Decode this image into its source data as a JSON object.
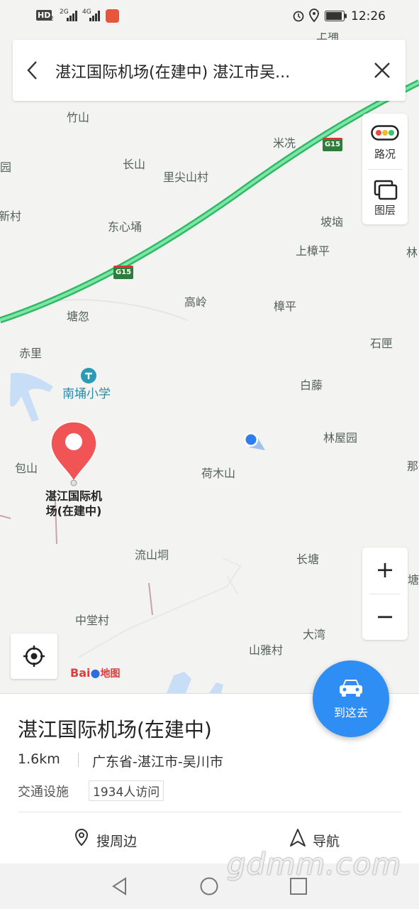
{
  "status": {
    "hd": "HD",
    "hd_sub": "2",
    "net1": "2G",
    "net2": "4G",
    "time": "12:26"
  },
  "search": {
    "title": "湛江国际机场(在建中) 湛江市吴..."
  },
  "side": {
    "traffic_label": "路况",
    "layers_label": "图层"
  },
  "map": {
    "highway_label": "G15",
    "places": [
      "上埇",
      "竹山",
      "米冼",
      "园",
      "长山",
      "里尖山村",
      "新村",
      "东心埇",
      "坡垴",
      "上樟平",
      "林",
      "高岭",
      "樟平",
      "塘忽",
      "赤里",
      "石匣",
      "白藤",
      "包山",
      "林屋园",
      "荷木山",
      "那",
      "流山垌",
      "长塘",
      "塘",
      "中堂村",
      "大湾",
      "山雅村"
    ],
    "poi_school": "南埇小学",
    "pin_label_line1": "湛江国际机",
    "pin_label_line2": "场(在建中)",
    "logo_text": "Bai",
    "logo_suffix": "地图"
  },
  "zoom": {
    "plus": "+",
    "minus": "−"
  },
  "go_button": {
    "label": "到这去"
  },
  "detail": {
    "name": "湛江国际机场(在建中)",
    "distance": "1.6km",
    "region": "广东省-湛江市-吴川市",
    "category": "交通设施",
    "visits": "1934人访问",
    "action_search": "搜周边",
    "action_nav": "导航"
  },
  "watermark": "gdmm.com",
  "colors": {
    "highway": "#3fcf7f",
    "accent": "#2f8ef3",
    "pin": "#f04e4e",
    "water": "#c8def6"
  }
}
